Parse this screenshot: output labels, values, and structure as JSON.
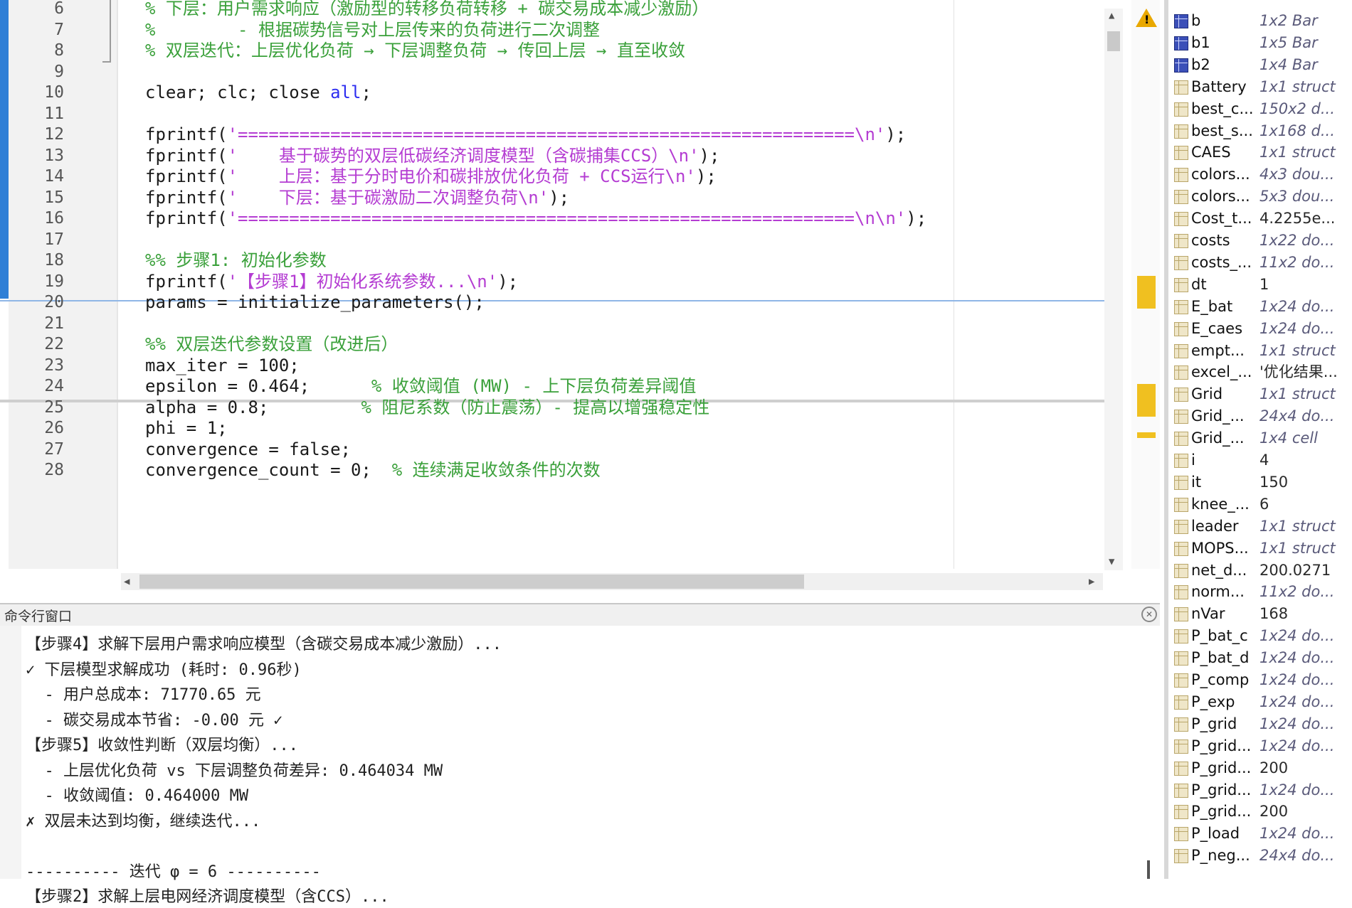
{
  "editor": {
    "lines": [
      {
        "n": "6",
        "parts": [
          {
            "c": "cmt",
            "t": "% 下层：用户需求响应（激励型的转移负荷转移 + 碳交易成本减少激励）"
          }
        ]
      },
      {
        "n": "7",
        "parts": [
          {
            "c": "cmt",
            "t": "%        - 根据碳势信号对上层传来的负荷进行二次调整"
          }
        ]
      },
      {
        "n": "8",
        "parts": [
          {
            "c": "cmt",
            "t": "% 双层迭代：上层优化负荷 → 下层调整负荷 → 传回上层 → 直至收敛"
          }
        ]
      },
      {
        "n": "9",
        "parts": []
      },
      {
        "n": "10",
        "parts": [
          {
            "c": "plain",
            "t": "clear; clc; close "
          },
          {
            "c": "kw",
            "t": "all"
          },
          {
            "c": "plain",
            "t": ";"
          }
        ]
      },
      {
        "n": "11",
        "parts": []
      },
      {
        "n": "12",
        "parts": [
          {
            "c": "plain",
            "t": "fprintf("
          },
          {
            "c": "str",
            "t": "'============================================================\\n'"
          },
          {
            "c": "plain",
            "t": ");"
          }
        ]
      },
      {
        "n": "13",
        "parts": [
          {
            "c": "plain",
            "t": "fprintf("
          },
          {
            "c": "str",
            "t": "'    基于碳势的双层低碳经济调度模型（含碳捕集CCS）\\n'"
          },
          {
            "c": "plain",
            "t": ");"
          }
        ]
      },
      {
        "n": "14",
        "parts": [
          {
            "c": "plain",
            "t": "fprintf("
          },
          {
            "c": "str",
            "t": "'    上层：基于分时电价和碳排放优化负荷 + CCS运行\\n'"
          },
          {
            "c": "plain",
            "t": ");"
          }
        ]
      },
      {
        "n": "15",
        "parts": [
          {
            "c": "plain",
            "t": "fprintf("
          },
          {
            "c": "str",
            "t": "'    下层：基于碳激励二次调整负荷\\n'"
          },
          {
            "c": "plain",
            "t": ");"
          }
        ]
      },
      {
        "n": "16",
        "parts": [
          {
            "c": "plain",
            "t": "fprintf("
          },
          {
            "c": "str",
            "t": "'============================================================\\n\\n'"
          },
          {
            "c": "plain",
            "t": ");"
          }
        ]
      },
      {
        "n": "17",
        "parts": []
      },
      {
        "n": "18",
        "parts": [
          {
            "c": "cmt",
            "t": "%% 步骤1: 初始化参数"
          }
        ]
      },
      {
        "n": "19",
        "parts": [
          {
            "c": "plain",
            "t": "fprintf("
          },
          {
            "c": "str",
            "t": "'【步骤1】初始化系统参数...\\n'"
          },
          {
            "c": "plain",
            "t": ");"
          }
        ]
      },
      {
        "n": "20",
        "parts": [
          {
            "c": "plain",
            "t": "params = initialize_parameters();"
          }
        ]
      },
      {
        "n": "21",
        "parts": []
      },
      {
        "n": "22",
        "parts": [
          {
            "c": "cmt",
            "t": "%% 双层迭代参数设置（改进后）"
          }
        ]
      },
      {
        "n": "23",
        "parts": [
          {
            "c": "plain",
            "t": "max_iter = 100;"
          }
        ]
      },
      {
        "n": "24",
        "parts": [
          {
            "c": "plain",
            "t": "epsilon = 0.464;      "
          },
          {
            "c": "cmt",
            "t": "% 收敛阈值 (MW) - 上下层负荷差异阈值"
          }
        ]
      },
      {
        "n": "25",
        "parts": [
          {
            "c": "plain",
            "t": "alpha = 0.8;         "
          },
          {
            "c": "cmt",
            "t": "% 阻尼系数（防止震荡）- 提高以增强稳定性"
          }
        ]
      },
      {
        "n": "26",
        "parts": [
          {
            "c": "plain",
            "t": "phi = 1;"
          }
        ]
      },
      {
        "n": "27",
        "parts": [
          {
            "c": "plain",
            "t": "convergence = false;"
          }
        ]
      },
      {
        "n": "28",
        "parts": [
          {
            "c": "plain",
            "t": "convergence_count = 0;  "
          },
          {
            "c": "cmt",
            "t": "% 连续满足收敛条件的次数"
          }
        ]
      }
    ]
  },
  "command_window": {
    "title": "命令行窗口",
    "lines": [
      "【步骤4】求解下层用户需求响应模型（含碳交易成本减少激励）...",
      "✓ 下层模型求解成功 (耗时: 0.96秒)",
      "  - 用户总成本: 71770.65 元",
      "  - 碳交易成本节省: -0.00 元 ✓",
      "【步骤5】收敛性判断（双层均衡）...",
      "  - 上层优化负荷 vs 下层调整负荷差异: 0.464034 MW",
      "  - 收敛阈值: 0.464000 MW",
      "✗ 双层未达到均衡，继续迭代...",
      "",
      "---------- 迭代 φ = 6 ----------",
      "【步骤2】求解上层电网经济调度模型（含CCS）..."
    ]
  },
  "workspace": {
    "rows": [
      {
        "name": "b",
        "value": "1x2 Bar",
        "icon": "bar",
        "italic": true
      },
      {
        "name": "b1",
        "value": "1x5 Bar",
        "icon": "bar",
        "italic": true
      },
      {
        "name": "b2",
        "value": "1x4 Bar",
        "icon": "bar",
        "italic": true
      },
      {
        "name": "Battery",
        "value": "1x1 struct",
        "icon": "grid",
        "italic": true
      },
      {
        "name": "best_c...",
        "value": "150x2 d...",
        "icon": "grid",
        "italic": true
      },
      {
        "name": "best_s...",
        "value": "1x168 d...",
        "icon": "grid",
        "italic": true
      },
      {
        "name": "CAES",
        "value": "1x1 struct",
        "icon": "grid",
        "italic": true
      },
      {
        "name": "colors...",
        "value": "4x3 dou...",
        "icon": "grid",
        "italic": true
      },
      {
        "name": "colors...",
        "value": "5x3 dou...",
        "icon": "grid",
        "italic": true
      },
      {
        "name": "Cost_t...",
        "value": "4.2255e...",
        "icon": "grid",
        "italic": false
      },
      {
        "name": "costs",
        "value": "1x22 do...",
        "icon": "grid",
        "italic": true
      },
      {
        "name": "costs_...",
        "value": "11x2 do...",
        "icon": "grid",
        "italic": true
      },
      {
        "name": "dt",
        "value": "1",
        "icon": "grid",
        "italic": false
      },
      {
        "name": "E_bat",
        "value": "1x24 do...",
        "icon": "grid",
        "italic": true
      },
      {
        "name": "E_caes",
        "value": "1x24 do...",
        "icon": "grid",
        "italic": true
      },
      {
        "name": "empt...",
        "value": "1x1 struct",
        "icon": "grid",
        "italic": true
      },
      {
        "name": "excel_...",
        "value": "'优化结果...",
        "icon": "grid",
        "italic": false
      },
      {
        "name": "Grid",
        "value": "1x1 struct",
        "icon": "grid",
        "italic": true
      },
      {
        "name": "Grid_...",
        "value": "24x4 do...",
        "icon": "grid",
        "italic": true
      },
      {
        "name": "Grid_...",
        "value": "1x4 cell",
        "icon": "grid",
        "italic": true
      },
      {
        "name": "i",
        "value": "4",
        "icon": "grid",
        "italic": false
      },
      {
        "name": "it",
        "value": "150",
        "icon": "grid",
        "italic": false
      },
      {
        "name": "knee_...",
        "value": "6",
        "icon": "grid",
        "italic": false
      },
      {
        "name": "leader",
        "value": "1x1 struct",
        "icon": "grid",
        "italic": true
      },
      {
        "name": "MOPS...",
        "value": "1x1 struct",
        "icon": "grid",
        "italic": true
      },
      {
        "name": "net_d...",
        "value": "200.0271",
        "icon": "grid",
        "italic": false
      },
      {
        "name": "norm...",
        "value": "11x2 do...",
        "icon": "grid",
        "italic": true
      },
      {
        "name": "nVar",
        "value": "168",
        "icon": "grid",
        "italic": false
      },
      {
        "name": "P_bat_c",
        "value": "1x24 do...",
        "icon": "grid",
        "italic": true
      },
      {
        "name": "P_bat_d",
        "value": "1x24 do...",
        "icon": "grid",
        "italic": true
      },
      {
        "name": "P_comp",
        "value": "1x24 do...",
        "icon": "grid",
        "italic": true
      },
      {
        "name": "P_exp",
        "value": "1x24 do...",
        "icon": "grid",
        "italic": true
      },
      {
        "name": "P_grid",
        "value": "1x24 do...",
        "icon": "grid",
        "italic": true
      },
      {
        "name": "P_grid...",
        "value": "1x24 do...",
        "icon": "grid",
        "italic": true
      },
      {
        "name": "P_grid...",
        "value": "200",
        "icon": "grid",
        "italic": false
      },
      {
        "name": "P_grid...",
        "value": "1x24 do...",
        "icon": "grid",
        "italic": true
      },
      {
        "name": "P_grid...",
        "value": "200",
        "icon": "grid",
        "italic": false
      },
      {
        "name": "P_load",
        "value": "1x24 do...",
        "icon": "grid",
        "italic": true
      },
      {
        "name": "P_neg...",
        "value": "24x4 do...",
        "icon": "grid",
        "italic": true
      }
    ]
  }
}
